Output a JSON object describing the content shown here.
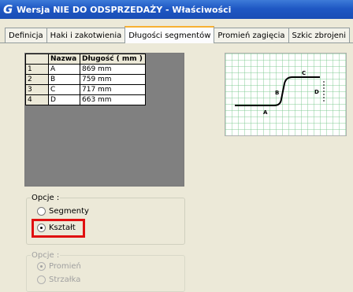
{
  "window": {
    "title": "Wersja NIE DO ODSPRZEDAŻY - Właściwości",
    "icon": "G"
  },
  "tabs": [
    {
      "label": "Definicja"
    },
    {
      "label": "Haki i zakotwienia"
    },
    {
      "label": "Długości segmentów"
    },
    {
      "label": "Promień zagięcia"
    },
    {
      "label": "Szkic zbrojeni"
    }
  ],
  "table": {
    "headers": [
      "Nazwa",
      "Długość ( mm )"
    ],
    "rows": [
      {
        "num": "1",
        "name": "A",
        "length": "869 mm"
      },
      {
        "num": "2",
        "name": "B",
        "length": "759 mm"
      },
      {
        "num": "3",
        "name": "C",
        "length": "717 mm"
      },
      {
        "num": "4",
        "name": "D",
        "length": "663 mm"
      }
    ]
  },
  "preview": {
    "labels": {
      "a": "A",
      "b": "B",
      "c": "C",
      "d": "D"
    }
  },
  "options1": {
    "legend": "Opcje :",
    "segmenty": "Segmenty",
    "ksztalt": "Kształt",
    "selected": "ksztalt"
  },
  "options2": {
    "legend": "Opcje :",
    "promien": "Promień",
    "strzalka": "Strzałka",
    "selected": "promien"
  },
  "colors": {
    "highlight": "#e01010",
    "grid": "#78c88c"
  }
}
